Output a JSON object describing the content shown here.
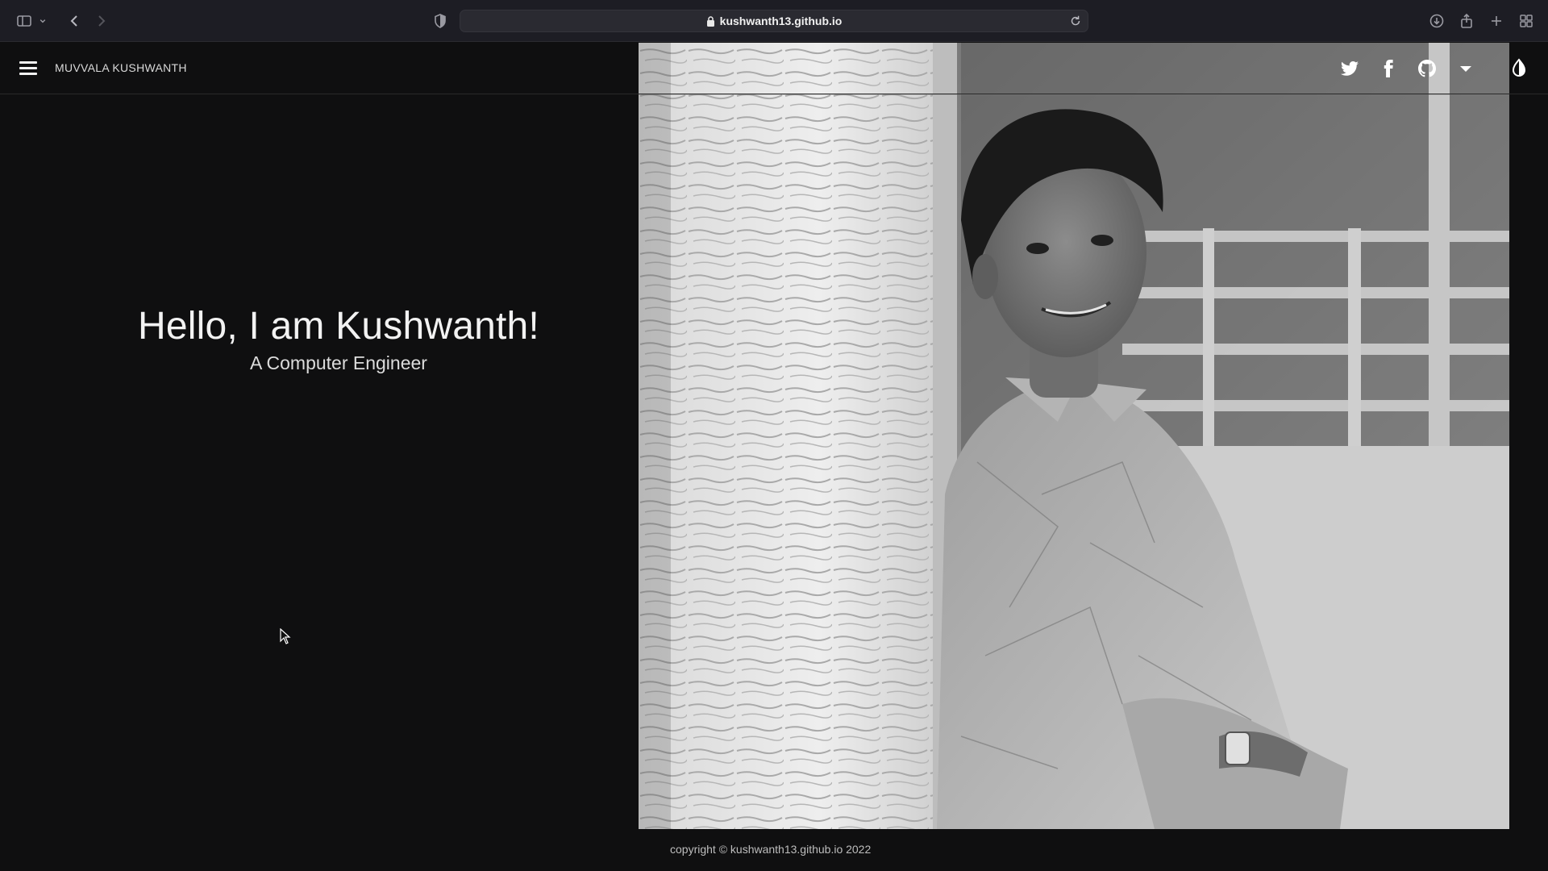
{
  "browser": {
    "url": "kushwanth13.github.io"
  },
  "header": {
    "brand": "MUVVALA KUSHWANTH",
    "social_icons": [
      "twitter-icon",
      "facebook-icon",
      "github-icon",
      "caret-down-icon"
    ],
    "theme_icon": "contrast-icon"
  },
  "hero": {
    "title": "Hello, I am Kushwanth!",
    "subtitle": "A Computer Engineer"
  },
  "footer": {
    "copyright": "copyright © kushwanth13.github.io 2022"
  },
  "colors": {
    "background": "#0f0f10",
    "chrome": "#1d1d24",
    "text": "#f2f2f2"
  }
}
